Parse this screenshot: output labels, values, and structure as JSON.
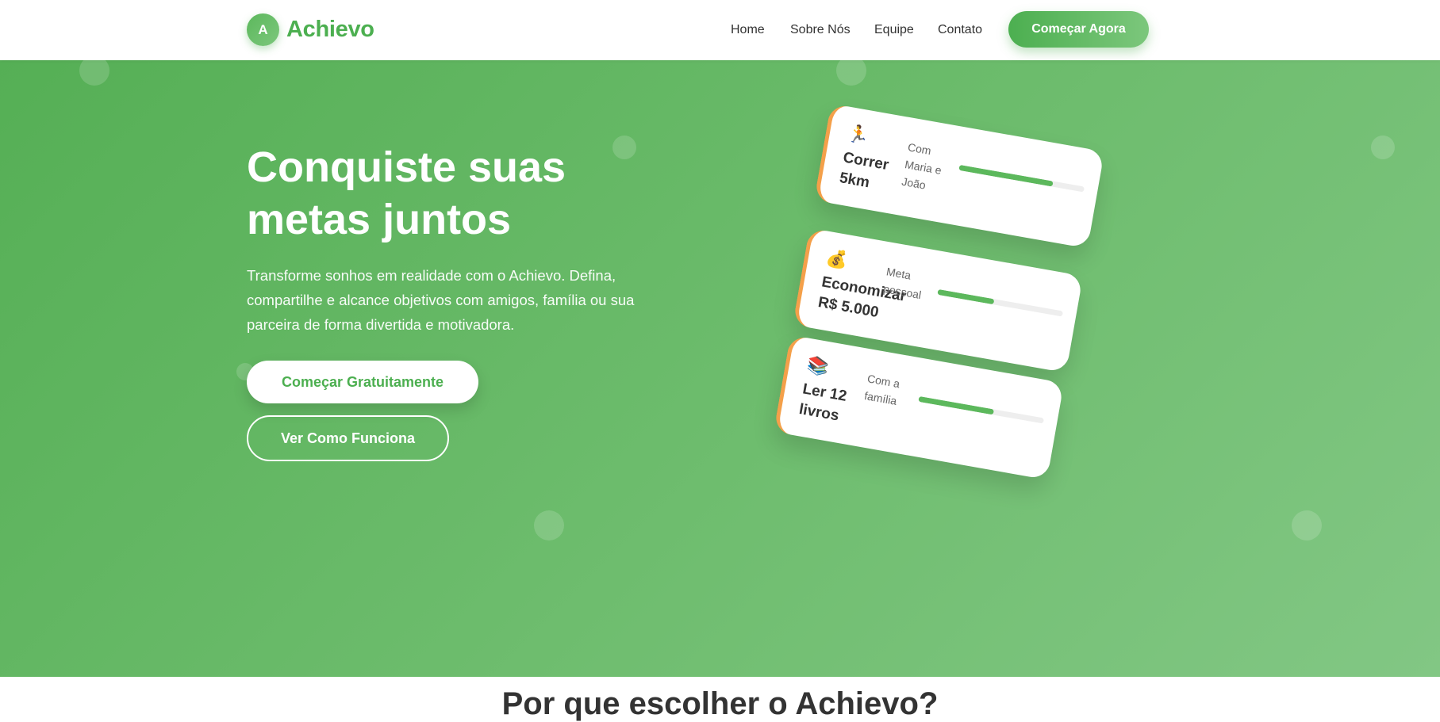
{
  "header": {
    "logo_letter": "A",
    "brand": "Achievo",
    "nav": [
      {
        "label": "Home"
      },
      {
        "label": "Sobre Nós"
      },
      {
        "label": "Equipe"
      },
      {
        "label": "Contato"
      }
    ],
    "cta_label": "Começar Agora"
  },
  "hero": {
    "title": "Conquiste suas metas juntos",
    "subtitle": "Transforme sonhos em realidade com o Achievo. Defina, compartilhe e alcance objetivos com amigos, família ou sua parceira de forma divertida e motivadora.",
    "primary_button": "Começar Gratuitamente",
    "secondary_button": "Ver Como Funciona"
  },
  "goal_cards": [
    {
      "emoji": "🏃",
      "emoji_icon": "runner-icon",
      "title": "Correr 5km",
      "meta": "Com Maria e João",
      "progress": 0.75
    },
    {
      "emoji": "💰",
      "emoji_icon": "money-bag-icon",
      "title": "Economizar R$ 5.000",
      "meta": "Meta pessoal",
      "progress": 0.45
    },
    {
      "emoji": "📚",
      "emoji_icon": "books-icon",
      "title": "Ler 12 livros",
      "meta": "Com a família",
      "progress": 0.6
    }
  ],
  "why_section": {
    "title": "Por que escolher o Achievo?"
  },
  "colors": {
    "brand_green": "#4caf50",
    "accent_orange": "#f4a04a"
  }
}
